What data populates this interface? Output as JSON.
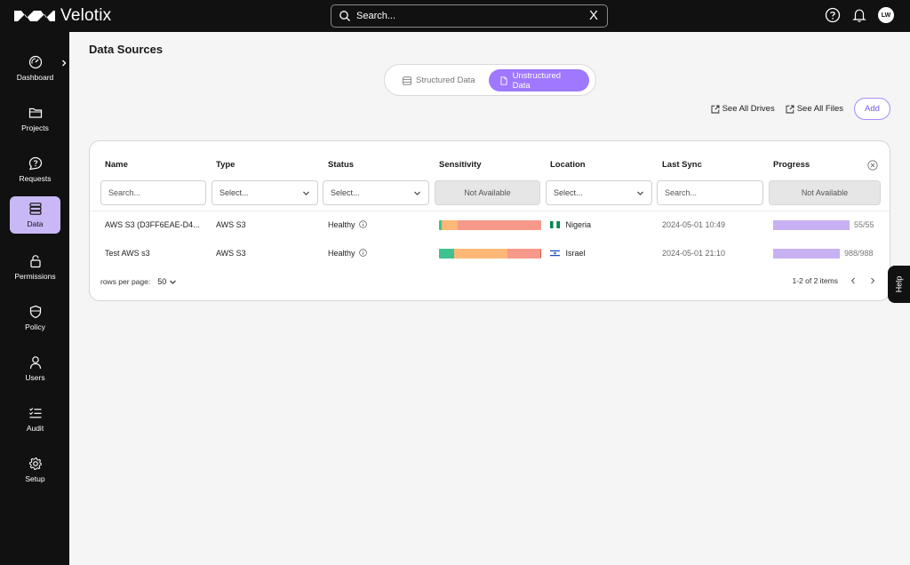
{
  "app": {
    "name": "Velotix",
    "search_placeholder": "Search...",
    "clear_glyph": "X",
    "avatar_initials": "LW"
  },
  "icons": {
    "help": "help-circle-icon",
    "notifications": "bell-icon",
    "search": "search-icon"
  },
  "sidebar": {
    "items": [
      {
        "label": "Dashboard",
        "icon": "gauge-icon",
        "active": false
      },
      {
        "label": "Projects",
        "icon": "folder-icon",
        "active": false
      },
      {
        "label": "Requests",
        "icon": "chat-question-icon",
        "active": false
      },
      {
        "label": "Data",
        "icon": "database-icon",
        "active": true
      },
      {
        "label": "Permissions",
        "icon": "lock-icon",
        "active": false
      },
      {
        "label": "Policy",
        "icon": "shield-icon",
        "active": false
      },
      {
        "label": "Users",
        "icon": "user-icon",
        "active": false
      },
      {
        "label": "Audit",
        "icon": "checklist-icon",
        "active": false
      },
      {
        "label": "Setup",
        "icon": "gear-icon",
        "active": false
      }
    ]
  },
  "page": {
    "title": "Data Sources",
    "tabs": [
      {
        "label": "Structured Data",
        "active": false
      },
      {
        "label": "Unstructured Data",
        "active": true
      }
    ],
    "actions": {
      "see_all_drives": "See All Drives",
      "see_all_files": "See All Files",
      "add": "Add"
    }
  },
  "table": {
    "columns": [
      "Name",
      "Type",
      "Status",
      "Sensitivity",
      "Location",
      "Last Sync",
      "Progress"
    ],
    "filters": {
      "name_placeholder": "Search...",
      "type_placeholder": "Select...",
      "status_placeholder": "Select...",
      "sensitivity": "Not Available",
      "location_placeholder": "Select...",
      "last_sync_placeholder": "Search...",
      "progress": "Not Available"
    },
    "rows": [
      {
        "name": "AWS S3 (D3FF6EAE-D4...",
        "type": "AWS S3",
        "status": "Healthy",
        "sensitivity": [
          {
            "color": "#3ec28f",
            "fraction": 0.03
          },
          {
            "color": "#ffb877",
            "fraction": 0.15
          },
          {
            "color": "#f7998a",
            "fraction": 0.82
          }
        ],
        "location": "Nigeria",
        "location_flag": "nigeria-flag-icon",
        "last_sync": "2024-05-01 10:49",
        "progress_fraction": 1.0,
        "progress_text": "55/55"
      },
      {
        "name": "Test AWS s3",
        "type": "AWS S3",
        "status": "Healthy",
        "sensitivity": [
          {
            "color": "#3ec28f",
            "fraction": 0.15
          },
          {
            "color": "#ffb877",
            "fraction": 0.52
          },
          {
            "color": "#f7998a",
            "fraction": 0.32
          },
          {
            "color": "#e05a4a",
            "fraction": 0.01
          }
        ],
        "location": "Israel",
        "location_flag": "israel-flag-icon",
        "last_sync": "2024-05-01 21:10",
        "progress_fraction": 1.0,
        "progress_text": "988/988"
      }
    ],
    "footer": {
      "rows_per_page_label": "rows per page:",
      "rows_per_page_value": "50",
      "range_text": "1-2 of 2 items"
    }
  },
  "help_tab": "Help",
  "colors": {
    "accent": "#9f78ff",
    "active_nav": "#c9b8f5",
    "progress": "#c8b1f3",
    "topbar": "#111111"
  }
}
